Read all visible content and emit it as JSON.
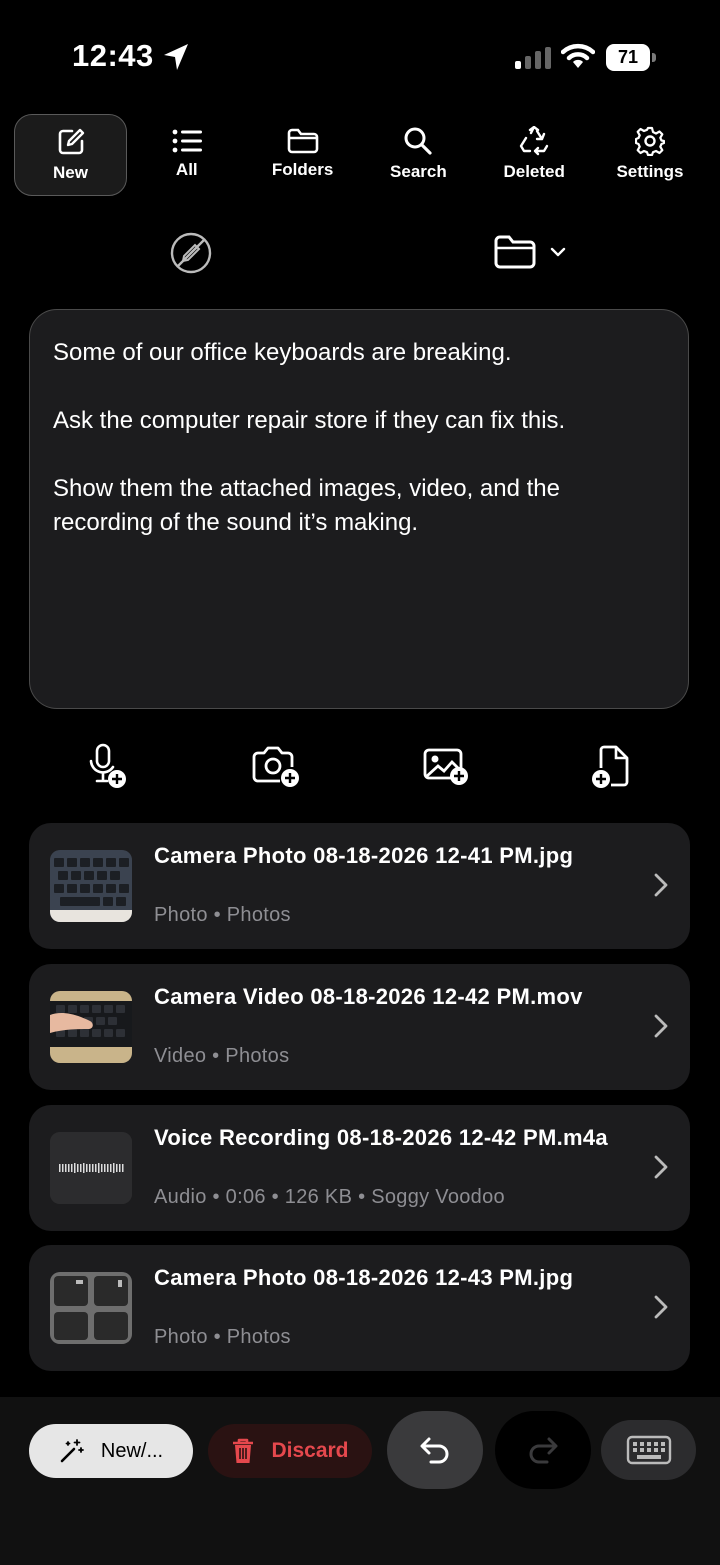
{
  "status_bar": {
    "time": "12:43",
    "battery": "71",
    "icons": [
      "location-arrow-icon",
      "cellular-signal-icon",
      "wifi-icon",
      "battery-icon"
    ]
  },
  "toolbar": {
    "items": [
      {
        "label": "New",
        "icon": "compose-icon",
        "active": true
      },
      {
        "label": "All",
        "icon": "list-icon"
      },
      {
        "label": "Folders",
        "icon": "folder-icon"
      },
      {
        "label": "Search",
        "icon": "search-icon"
      },
      {
        "label": "Deleted",
        "icon": "recycle-icon"
      },
      {
        "label": "Settings",
        "icon": "gear-icon"
      }
    ]
  },
  "note": {
    "text": "Some of our office keyboards are breaking.\n\nAsk the computer repair store if they can fix this.\n\nShow them the attached images, video, and the recording of the sound it’s making."
  },
  "attach_actions": [
    "add-audio-icon",
    "add-camera-icon",
    "add-image-icon",
    "add-file-icon"
  ],
  "attachments": [
    {
      "title": "Camera Photo 08-18-2026 12-41 PM.jpg",
      "meta": "Photo • Photos",
      "thumb": "keyboard-photo"
    },
    {
      "title": "Camera Video 08-18-2026 12-42 PM.mov",
      "meta": "Video • Photos",
      "thumb": "keyboard-video"
    },
    {
      "title": "Voice Recording 08-18-2026 12-42 PM.m4a",
      "meta": "Audio • 0:06 • 126 KB • Soggy Voodoo",
      "thumb": "waveform"
    },
    {
      "title": "Camera Photo 08-18-2026 12-43 PM.jpg",
      "meta": "Photo • Photos",
      "thumb": "keycap-photo"
    }
  ],
  "bottom_bar": {
    "new_label": "New/...",
    "discard_label": "Discard",
    "colors": {
      "discard": "#e5484d"
    }
  }
}
